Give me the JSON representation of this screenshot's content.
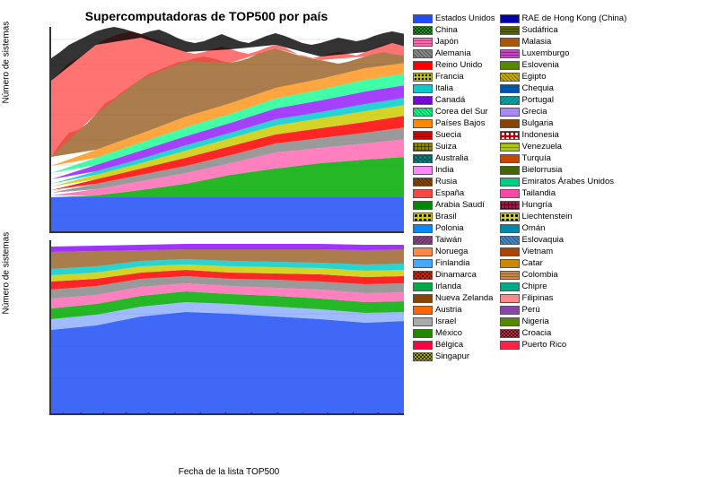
{
  "title": "Supercomputadoras de TOP500 por país",
  "yLabel1": "Número de sistemas",
  "yLabel2": "Número de sistemas",
  "xLabel": "Fecha de la lista TOP500",
  "legend": {
    "col1": [
      {
        "label": "Estados Unidos",
        "color": "#1f4ef5",
        "pattern": "solid"
      },
      {
        "label": "China",
        "color": "#00aa00",
        "pattern": "stars"
      },
      {
        "label": "Japón",
        "color": "#ff69b4",
        "pattern": "dots"
      },
      {
        "label": "Alemania",
        "color": "#888888",
        "pattern": "hatched"
      },
      {
        "label": "Reino Unido",
        "color": "#ff0000",
        "pattern": "solid"
      },
      {
        "label": "Francia",
        "color": "#cccc00",
        "pattern": "circles"
      },
      {
        "label": "Italia",
        "color": "#00cccc",
        "pattern": "solid"
      },
      {
        "label": "Canadá",
        "color": "#8800ff",
        "pattern": "hatched"
      },
      {
        "label": "Corea del Sur",
        "color": "#00ff88",
        "pattern": "hatched"
      },
      {
        "label": "Países Bajos",
        "color": "#ff8800",
        "pattern": "solid"
      },
      {
        "label": "Suecia",
        "color": "#dd0000",
        "pattern": "dots"
      },
      {
        "label": "Suiza",
        "color": "#888800",
        "pattern": "cross"
      },
      {
        "label": "Australia",
        "color": "#008888",
        "pattern": "circles"
      },
      {
        "label": "India",
        "color": "#ff88ff",
        "pattern": "solid"
      },
      {
        "label": "Rusia",
        "color": "#884400",
        "pattern": "hatched"
      },
      {
        "label": "España",
        "color": "#ff4444",
        "pattern": "solid"
      },
      {
        "label": "Arabia Saudí",
        "color": "#008800",
        "pattern": "solid"
      },
      {
        "label": "Brasil",
        "color": "#cccc00",
        "pattern": "circles"
      },
      {
        "label": "Polonia",
        "color": "#0088ff",
        "pattern": "solid"
      },
      {
        "label": "Taiwán",
        "color": "#884488",
        "pattern": "hatched"
      },
      {
        "label": "Noruega",
        "color": "#ff8844",
        "pattern": "solid"
      },
      {
        "label": "Finlandia",
        "color": "#44aaff",
        "pattern": "solid"
      },
      {
        "label": "Dinamarca",
        "color": "#cc2200",
        "pattern": "stars"
      },
      {
        "label": "Irlanda",
        "color": "#00aa44",
        "pattern": "solid"
      },
      {
        "label": "Nueva Zelanda",
        "color": "#884400",
        "pattern": "solid"
      },
      {
        "label": "Austria",
        "color": "#ff6600",
        "pattern": "solid"
      },
      {
        "label": "Israel",
        "color": "#aaaaaa",
        "pattern": "solid"
      },
      {
        "label": "México",
        "color": "#228800",
        "pattern": "solid"
      },
      {
        "label": "Bélgica",
        "color": "#ff0044",
        "pattern": "solid"
      },
      {
        "label": "Singapur",
        "color": "#aaaa00",
        "pattern": "stars"
      }
    ],
    "col2": [
      {
        "label": "RAE de Hong Kong (China)",
        "color": "#0000aa",
        "pattern": "solid"
      },
      {
        "label": "Sudáfrica",
        "color": "#556600",
        "pattern": "dots"
      },
      {
        "label": "Malasia",
        "color": "#aa5500",
        "pattern": "solid"
      },
      {
        "label": "Luxemburgo",
        "color": "#cc44cc",
        "pattern": "dots"
      },
      {
        "label": "Eslovenia",
        "color": "#558800",
        "pattern": "solid"
      },
      {
        "label": "Egipto",
        "color": "#ccaa00",
        "pattern": "hatched"
      },
      {
        "label": "Chequia",
        "color": "#0055aa",
        "pattern": "solid"
      },
      {
        "label": "Portugal",
        "color": "#00aaaa",
        "pattern": "hatched"
      },
      {
        "label": "Grecia",
        "color": "#aa88ff",
        "pattern": "solid"
      },
      {
        "label": "Bulgaria",
        "color": "#884400",
        "pattern": "solid"
      },
      {
        "label": "Indonesia",
        "color": "#cc0000",
        "pattern": "circles"
      },
      {
        "label": "Venezuela",
        "color": "#aacc00",
        "pattern": "dotted"
      },
      {
        "label": "Turquía",
        "color": "#cc4400",
        "pattern": "solid"
      },
      {
        "label": "Bielorrusia",
        "color": "#446600",
        "pattern": "solid"
      },
      {
        "label": "Emiratos Árabes Unidos",
        "color": "#00cc88",
        "pattern": "solid"
      },
      {
        "label": "Tailandia",
        "color": "#ff44aa",
        "pattern": "solid"
      },
      {
        "label": "Hungría",
        "color": "#cc0044",
        "pattern": "cross"
      },
      {
        "label": "Liechtenstein",
        "color": "#cccc44",
        "pattern": "circles"
      },
      {
        "label": "Omán",
        "color": "#0088aa",
        "pattern": "solid"
      },
      {
        "label": "Eslovaquia",
        "color": "#4488cc",
        "pattern": "hatched"
      },
      {
        "label": "Vietnam",
        "color": "#aa4400",
        "pattern": "solid"
      },
      {
        "label": "Catar",
        "color": "#cc8800",
        "pattern": "solid"
      },
      {
        "label": "Colombia",
        "color": "#cc8844",
        "pattern": "dots"
      },
      {
        "label": "Chipre",
        "color": "#00aa88",
        "pattern": "solid"
      },
      {
        "label": "Filipinas",
        "color": "#ff8888",
        "pattern": "solid"
      },
      {
        "label": "Perú",
        "color": "#8844aa",
        "pattern": "solid"
      },
      {
        "label": "Nigeria",
        "color": "#558800",
        "pattern": "solid"
      },
      {
        "label": "Croacia",
        "color": "#cc2244",
        "pattern": "stars"
      },
      {
        "label": "Puerto Rico",
        "color": "#ff2244",
        "pattern": "solid"
      }
    ]
  }
}
